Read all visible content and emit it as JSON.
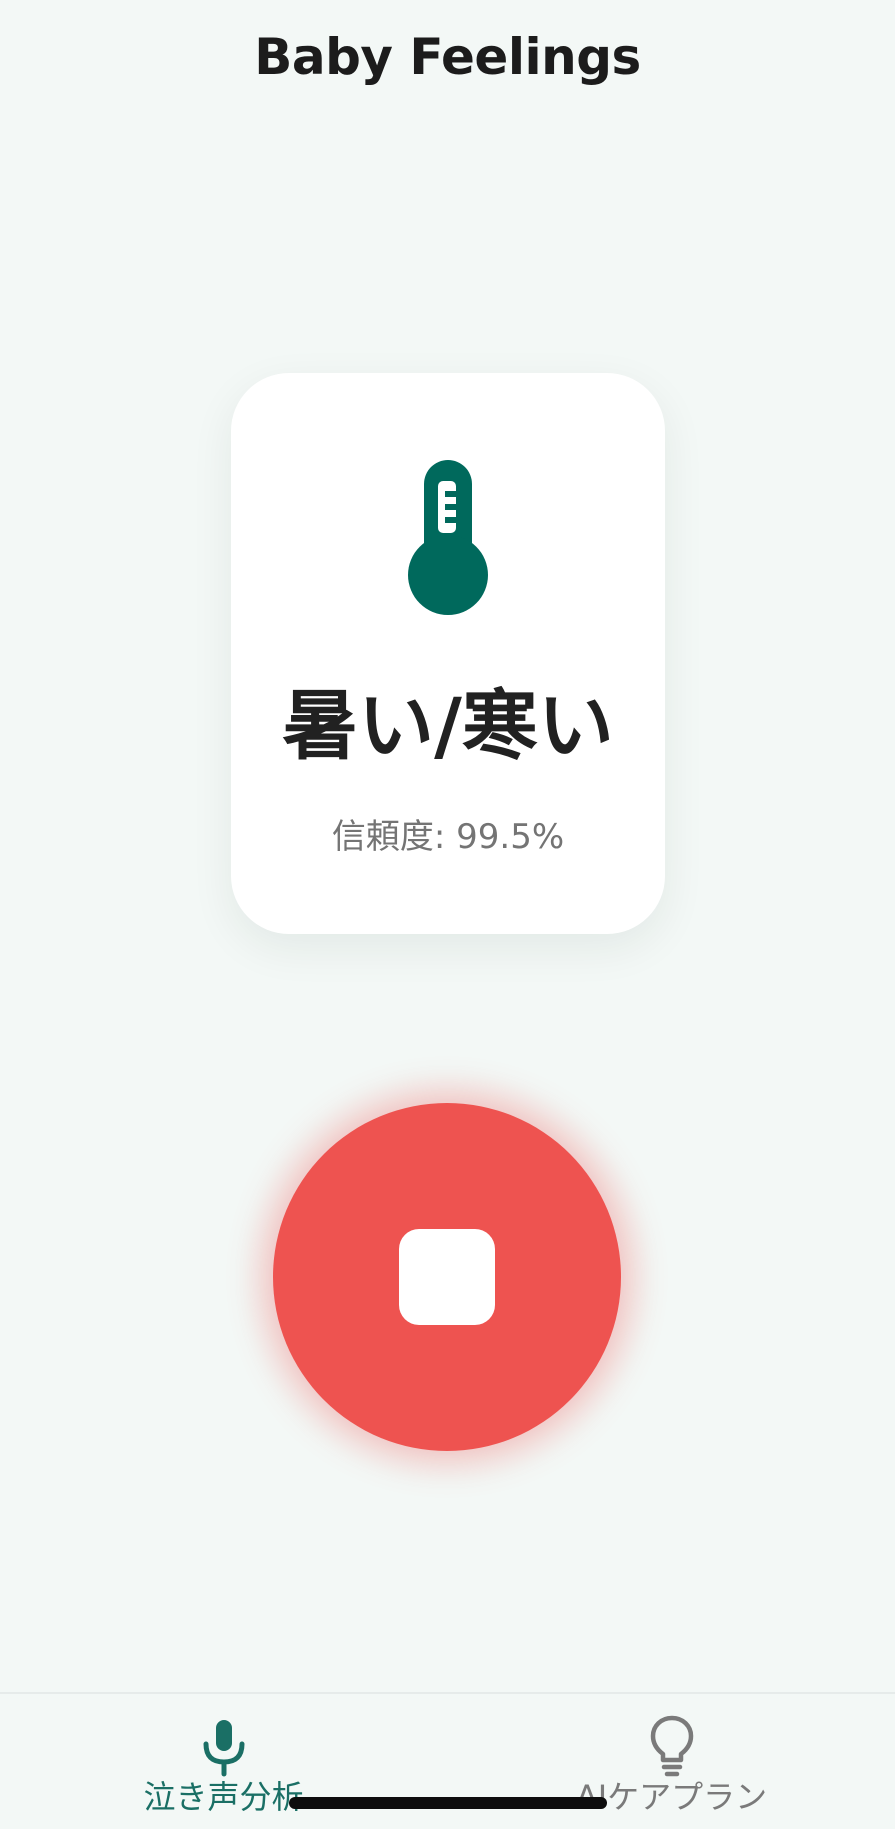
{
  "app": {
    "title": "Baby Feelings"
  },
  "result": {
    "icon": "thermometer-icon",
    "label": "暑い/寒い",
    "confidence_text": "信頼度: 99.5%",
    "confidence_value": 99.5
  },
  "record": {
    "state": "recording",
    "icon": "stop-icon"
  },
  "nav": {
    "items": [
      {
        "label": "泣き声分析",
        "icon": "microphone-icon",
        "active": true
      },
      {
        "label": "AIケアプラン",
        "icon": "lightbulb-icon",
        "active": false
      }
    ]
  },
  "colors": {
    "primary": "#00695c",
    "active_nav": "#1a6f65",
    "record_button": "#ee5350",
    "background": "#f3f8f6",
    "card": "#ffffff",
    "inactive_nav": "#7a7a7a"
  }
}
